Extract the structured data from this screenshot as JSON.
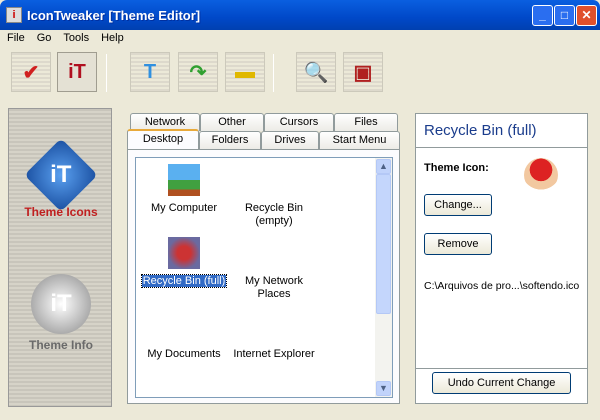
{
  "window": {
    "title": "IconTweaker [Theme Editor]",
    "minimize": "_",
    "maximize": "□",
    "close": "✕"
  },
  "menu": [
    "File",
    "Go",
    "Tools",
    "Help"
  ],
  "toolbar": [
    {
      "name": "apply-theme",
      "glyph": "✔",
      "color": "#d02020"
    },
    {
      "name": "theme-info",
      "glyph": "iT",
      "color": "#b01020"
    },
    {
      "name": "new-theme",
      "glyph": "T",
      "color": "#3090e0"
    },
    {
      "name": "open-theme",
      "glyph": "↷",
      "color": "#30a030"
    },
    {
      "name": "save-theme",
      "glyph": "▬",
      "color": "#e0b800"
    },
    {
      "name": "preview",
      "glyph": "🔍",
      "color": "#333333"
    },
    {
      "name": "system",
      "glyph": "▣",
      "color": "#b02020"
    }
  ],
  "sidebar": {
    "theme_icons": "Theme Icons",
    "theme_info": "Theme Info"
  },
  "tabs": {
    "row1": [
      "Network",
      "Other",
      "Cursors",
      "Files"
    ],
    "row2": [
      "Desktop",
      "Folders",
      "Drives",
      "Start Menu"
    ],
    "selected": "Desktop"
  },
  "icons": [
    {
      "label": "My Computer",
      "has_image": true
    },
    {
      "label": "Recycle Bin (empty)",
      "has_image": false
    },
    {
      "label": "Recycle Bin (full)",
      "has_image": true,
      "selected": true
    },
    {
      "label": "My Network Places",
      "has_image": false
    },
    {
      "label": "My Documents",
      "has_image": false
    },
    {
      "label": "Internet Explorer",
      "has_image": false
    }
  ],
  "details": {
    "title": "Recycle Bin (full)",
    "theme_icon_label": "Theme Icon:",
    "change": "Change...",
    "remove": "Remove",
    "path": "C:\\Arquivos de pro...\\softendo.ico",
    "undo": "Undo Current Change"
  },
  "colors": {
    "accent": "#316ac5",
    "title": "#1a3c8c"
  }
}
